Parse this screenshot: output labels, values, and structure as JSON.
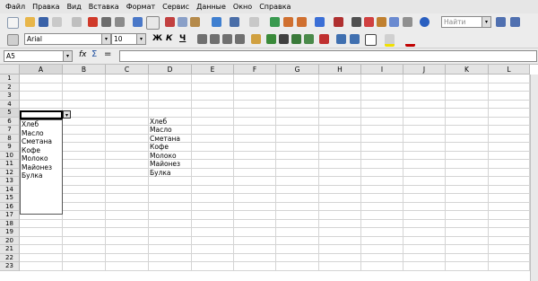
{
  "menu": [
    "Файл",
    "Правка",
    "Вид",
    "Вставка",
    "Формат",
    "Сервис",
    "Данные",
    "Окно",
    "Справка"
  ],
  "toolbar": {
    "search_placeholder": "Найти",
    "font_name": "Arial",
    "font_size": "10",
    "bold_label": "Ж",
    "italic_label": "К",
    "underline_label": "Ч"
  },
  "formula": {
    "name_box": "A5",
    "fx_label": "fx",
    "sum_label": "Σ",
    "eq_label": "=",
    "content": ""
  },
  "columns": [
    "A",
    "B",
    "C",
    "D",
    "E",
    "F",
    "G",
    "H",
    "I",
    "J",
    "K",
    "L"
  ],
  "rows": [
    "1",
    "2",
    "3",
    "4",
    "5",
    "6",
    "7",
    "8",
    "9",
    "10",
    "11",
    "12",
    "13",
    "14",
    "15",
    "16",
    "17",
    "18",
    "19",
    "20",
    "21",
    "22",
    "23"
  ],
  "cells_D": [
    "Хлеб",
    "Масло",
    "Сметана",
    "Кофе",
    "Молоко",
    "Майонез",
    "Булка"
  ],
  "dropdown_items": [
    "Хлеб",
    "Масло",
    "Сметана",
    "Кофе",
    "Молоко",
    "Майонез",
    "Булка"
  ],
  "dropdown_arrow": "▾"
}
